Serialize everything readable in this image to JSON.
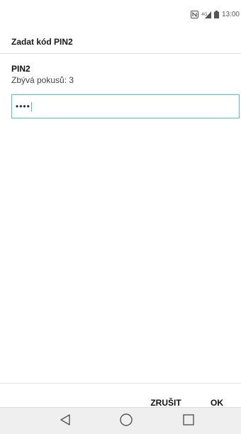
{
  "status_bar": {
    "time": "13:00",
    "icons": [
      "nfc-icon",
      "signal-icon",
      "battery-icon"
    ]
  },
  "header": {
    "title": "Zadat kód PIN2"
  },
  "form": {
    "field_label": "PIN2",
    "attempts_text": "Zbývá pokusů: 3",
    "pin_value": "••••"
  },
  "actions": {
    "cancel_label": "ZRUŠIT",
    "ok_label": "OK"
  },
  "navigation": {
    "icons": [
      "back-icon",
      "home-icon",
      "recent-apps-icon"
    ]
  },
  "colors": {
    "accent": "#4ec7c9",
    "nav_background": "#efefef"
  }
}
